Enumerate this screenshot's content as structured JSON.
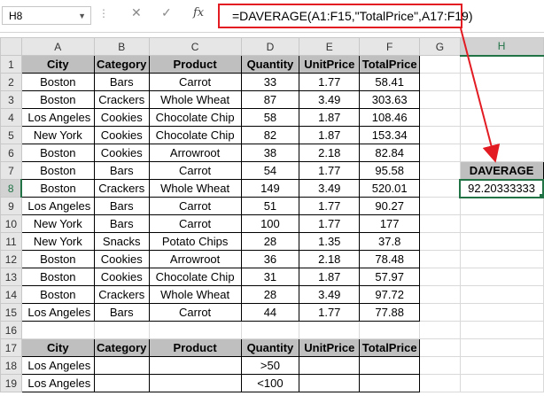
{
  "formula_bar": {
    "name_box": "H8",
    "formula": "=DAVERAGE(A1:F15,\"TotalPrice\",A17:F19)",
    "cancel_glyph": "✕",
    "enter_glyph": "✓",
    "fx_label": "fx"
  },
  "columns": [
    "A",
    "B",
    "C",
    "D",
    "E",
    "F",
    "G",
    "H"
  ],
  "rows": [
    "1",
    "2",
    "3",
    "4",
    "5",
    "6",
    "7",
    "8",
    "9",
    "10",
    "11",
    "12",
    "13",
    "14",
    "15",
    "16",
    "17",
    "18",
    "19"
  ],
  "headers": [
    "City",
    "Category",
    "Product",
    "Quantity",
    "UnitPrice",
    "TotalPrice"
  ],
  "data": [
    [
      "Boston",
      "Bars",
      "Carrot",
      "33",
      "1.77",
      "58.41"
    ],
    [
      "Boston",
      "Crackers",
      "Whole Wheat",
      "87",
      "3.49",
      "303.63"
    ],
    [
      "Los Angeles",
      "Cookies",
      "Chocolate Chip",
      "58",
      "1.87",
      "108.46"
    ],
    [
      "New York",
      "Cookies",
      "Chocolate Chip",
      "82",
      "1.87",
      "153.34"
    ],
    [
      "Boston",
      "Cookies",
      "Arrowroot",
      "38",
      "2.18",
      "82.84"
    ],
    [
      "Boston",
      "Bars",
      "Carrot",
      "54",
      "1.77",
      "95.58"
    ],
    [
      "Boston",
      "Crackers",
      "Whole Wheat",
      "149",
      "3.49",
      "520.01"
    ],
    [
      "Los Angeles",
      "Bars",
      "Carrot",
      "51",
      "1.77",
      "90.27"
    ],
    [
      "New York",
      "Bars",
      "Carrot",
      "100",
      "1.77",
      "177"
    ],
    [
      "New York",
      "Snacks",
      "Potato Chips",
      "28",
      "1.35",
      "37.8"
    ],
    [
      "Boston",
      "Cookies",
      "Arrowroot",
      "36",
      "2.18",
      "78.48"
    ],
    [
      "Boston",
      "Cookies",
      "Chocolate Chip",
      "31",
      "1.87",
      "57.97"
    ],
    [
      "Boston",
      "Crackers",
      "Whole Wheat",
      "28",
      "3.49",
      "97.72"
    ],
    [
      "Los Angeles",
      "Bars",
      "Carrot",
      "44",
      "1.77",
      "77.88"
    ]
  ],
  "criteria": [
    [
      "Los Angeles",
      "",
      "",
      ">50",
      "",
      ""
    ],
    [
      "Los Angeles",
      "",
      "",
      "<100",
      "",
      ""
    ]
  ],
  "result": {
    "label": "DAVERAGE",
    "value": "92.20333333"
  },
  "colors": {
    "header_fill": "#bfbfbf",
    "selection": "#217346",
    "annotation": "#e31b23"
  }
}
